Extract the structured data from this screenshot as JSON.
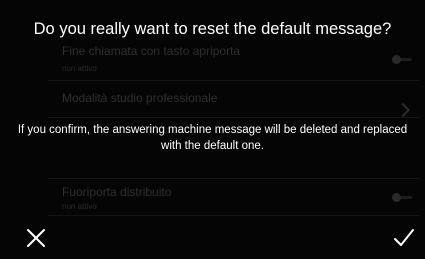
{
  "dialog": {
    "title": "Do you really want to reset the default message?",
    "message": "If you confirm, the answering machine message will be deleted and replaced with the default one.",
    "cancel_icon": "close-icon",
    "confirm_icon": "checkmark-icon"
  },
  "background_settings": {
    "items": [
      {
        "title": "Fine chiamata con tasto apriporta",
        "subtitle": "non attivo",
        "control": "toggle-off"
      },
      {
        "title": "Modalità studio professionale",
        "subtitle": "",
        "control": "chevron-right"
      },
      {
        "title": "",
        "subtitle": "",
        "control": "none"
      },
      {
        "title": "Fuoriporta distribuito",
        "subtitle": "non attivo",
        "control": "toggle-off"
      }
    ]
  }
}
